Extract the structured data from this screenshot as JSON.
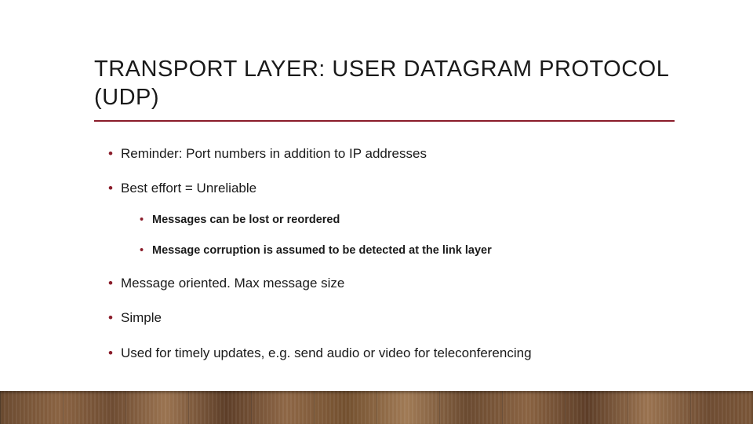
{
  "slide": {
    "title": "TRANSPORT LAYER: USER DATAGRAM PROTOCOL (UDP)",
    "bullets": [
      {
        "text": "Reminder: Port numbers in addition to IP addresses"
      },
      {
        "text": "Best effort = Unreliable",
        "children": [
          {
            "text": "Messages can be lost or reordered"
          },
          {
            "text": "Message corruption is assumed to be detected at the link layer"
          }
        ]
      },
      {
        "text": "Message oriented. Max message size"
      },
      {
        "text": "Simple"
      },
      {
        "text": "Used for timely updates, e.g. send audio or video for teleconferencing"
      }
    ]
  }
}
